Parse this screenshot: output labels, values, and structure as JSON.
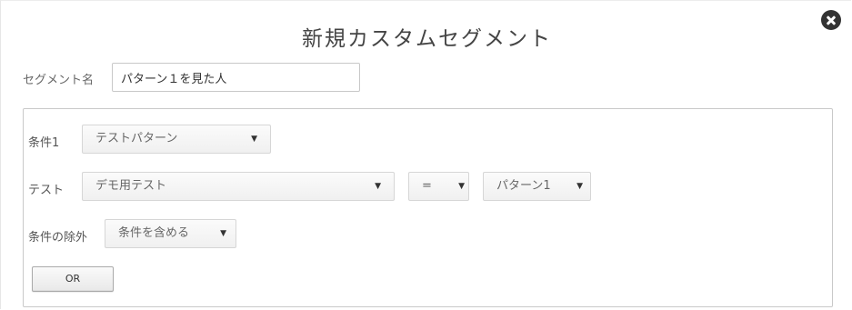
{
  "dialog": {
    "title": "新規カスタムセグメント",
    "close_icon": "close-circle-icon"
  },
  "segment_name": {
    "label": "セグメント名",
    "value": "パターン１を見た人"
  },
  "conditions": {
    "condition1": {
      "label": "条件1",
      "selected": "テストパターン"
    },
    "test": {
      "label": "テスト",
      "selected": "デモ用テスト",
      "operator": "=",
      "pattern": "パターン1"
    },
    "exclusion": {
      "label": "条件の除外",
      "selected": "条件を含める"
    },
    "or_button": "OR"
  },
  "caret_glyph": "▼"
}
